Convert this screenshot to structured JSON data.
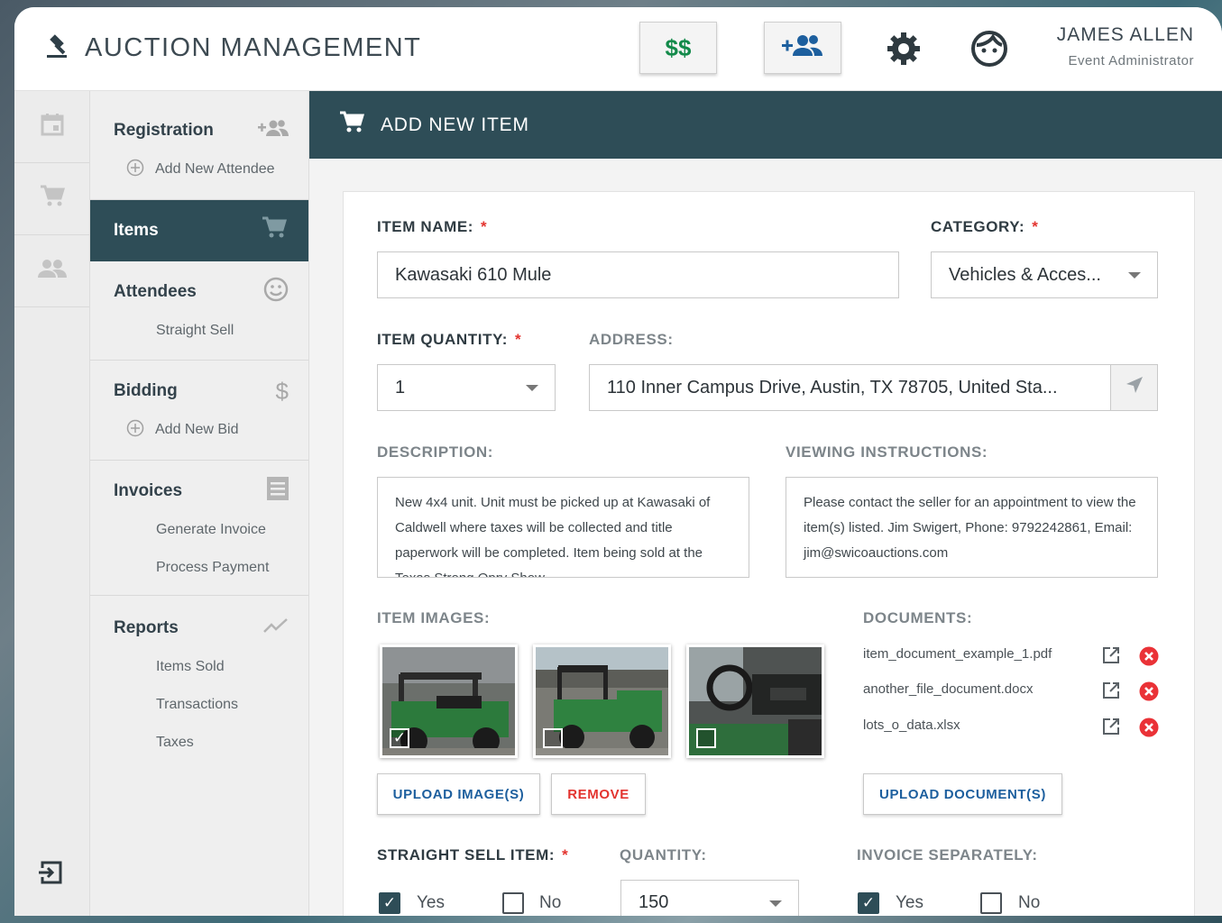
{
  "header": {
    "app_title": "AUCTION MANAGEMENT",
    "money_button": "$$",
    "user_name": "JAMES ALLEN",
    "user_role": "Event Administrator"
  },
  "nav": {
    "registration": {
      "title": "Registration",
      "sub": "Add New Attendee"
    },
    "items": {
      "title": "Items"
    },
    "attendees": {
      "title": "Attendees",
      "sub": "Straight Sell"
    },
    "bidding": {
      "title": "Bidding",
      "sub": "Add New Bid"
    },
    "invoices": {
      "title": "Invoices",
      "subs": [
        "Generate Invoice",
        "Process Payment"
      ]
    },
    "reports": {
      "title": "Reports",
      "subs": [
        "Items Sold",
        "Transactions",
        "Taxes"
      ]
    }
  },
  "page": {
    "title": "ADD NEW ITEM"
  },
  "form": {
    "item_name_label": "ITEM NAME:",
    "item_name_value": "Kawasaki 610 Mule",
    "category_label": "CATEGORY:",
    "category_value": "Vehicles & Acces...",
    "quantity_label": "ITEM QUANTITY:",
    "quantity_value": "1",
    "address_label": "ADDRESS:",
    "address_value": "110 Inner Campus Drive, Austin, TX 78705, United Sta...",
    "description_label": "DESCRIPTION:",
    "description_value": "New 4x4 unit. Unit must be picked up at Kawasaki of Caldwell where taxes will be collected and title paperwork will be completed. Item being sold at the Texas Strong Opry Show",
    "viewing_label": "VIEWING INSTRUCTIONS:",
    "viewing_value": "Please contact the seller for an appointment to view the item(s) listed. Jim Swigert, Phone: 9792242861, Email: jim@swicoauctions.com",
    "images_label": "ITEM IMAGES:",
    "images": [
      {
        "checked": true
      },
      {
        "checked": false
      },
      {
        "checked": false
      }
    ],
    "upload_images": "UPLOAD IMAGE(S)",
    "remove": "REMOVE",
    "documents_label": "DOCUMENTS:",
    "documents": [
      "item_document_example_1.pdf",
      "another_file_document.docx",
      "lots_o_data.xlsx"
    ],
    "upload_documents": "UPLOAD DOCUMENT(S)",
    "straight_sell_label": "STRAIGHT SELL ITEM:",
    "straight_sell": {
      "yes": "Yes",
      "no": "No",
      "selected": "Yes"
    },
    "sell_quantity_label": "QUANTITY:",
    "sell_quantity_value": "150",
    "invoice_sep_label": "INVOICE SEPARATELY:",
    "invoice_sep": {
      "yes": "Yes",
      "no": "No",
      "selected": "Yes"
    },
    "required_mark": "*"
  },
  "colors": {
    "primary": "#2e4d57",
    "accent_blue": "#1d5f9e",
    "danger": "#e3342f",
    "money_green": "#138a4a"
  }
}
